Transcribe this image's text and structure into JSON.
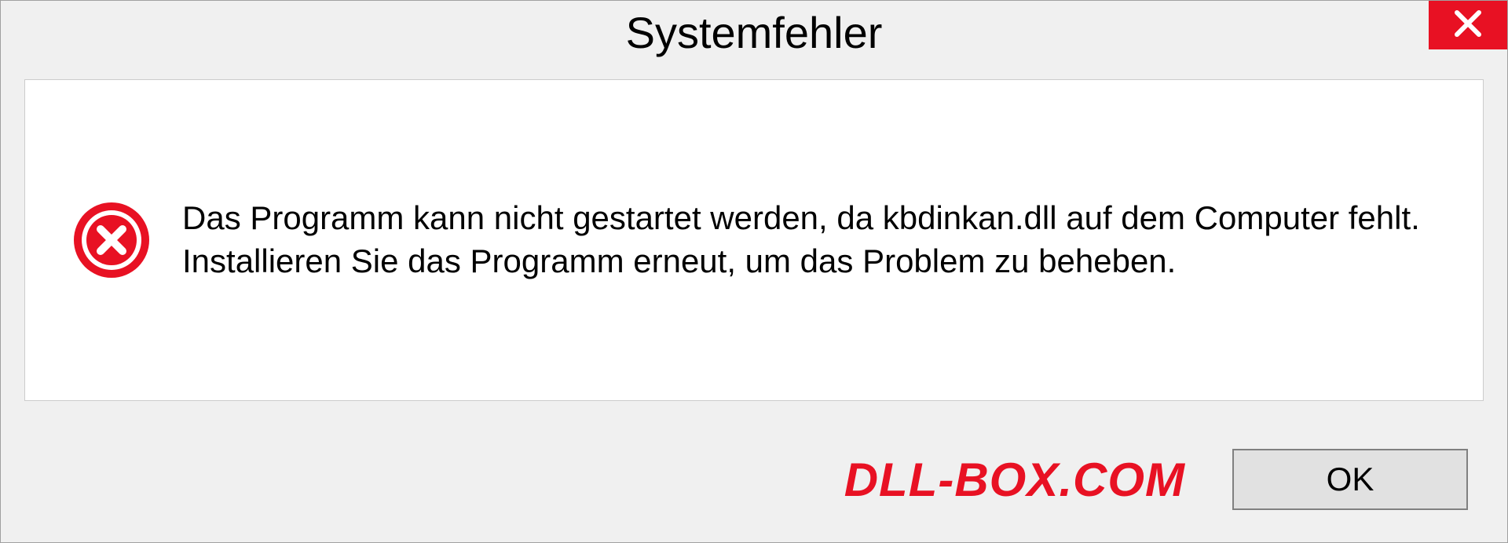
{
  "dialog": {
    "title": "Systemfehler",
    "message": "Das Programm kann nicht gestartet werden, da kbdinkan.dll auf dem Computer fehlt. Installieren Sie das Programm erneut, um das Problem zu beheben.",
    "ok_label": "OK"
  },
  "watermark": "DLL-BOX.COM"
}
